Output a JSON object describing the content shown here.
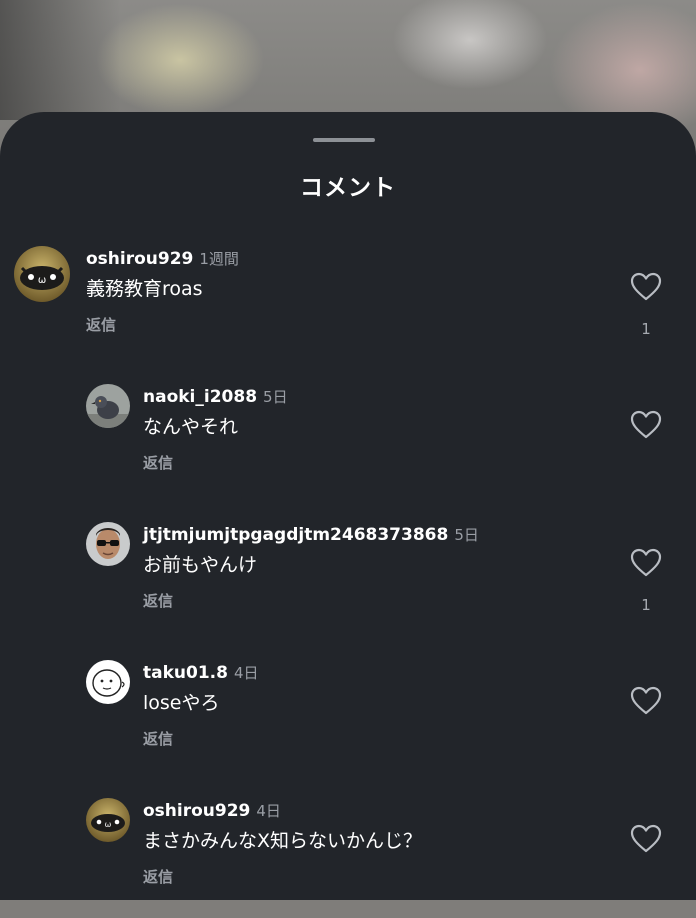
{
  "sheet": {
    "title": "コメント"
  },
  "comments": [
    {
      "username": "oshirou929",
      "time": "1週間",
      "text": "義務教育roas",
      "reply_label": "返信",
      "likes": "1",
      "avatar": "cat-face-avatar-icon"
    },
    {
      "username": "naoki_i2088",
      "time": "5日",
      "text": "なんやそれ",
      "reply_label": "返信",
      "likes": "",
      "avatar": "pigeon-avatar-icon"
    },
    {
      "username": "jtjtmjumjtpgagdjtm2468373868",
      "time": "5日",
      "text": "お前もやんけ",
      "reply_label": "返信",
      "likes": "1",
      "avatar": "person-sunglasses-avatar-icon"
    },
    {
      "username": "taku01.8",
      "time": "4日",
      "text": "loseやろ",
      "reply_label": "返信",
      "likes": "",
      "avatar": "doodle-face-avatar-icon"
    },
    {
      "username": "oshirou929",
      "time": "4日",
      "text": "まさかみんなX知らないかんじ？",
      "reply_label": "返信",
      "likes": "",
      "avatar": "cat-face-avatar-icon"
    }
  ],
  "icons": {
    "like": "heart-outline-icon"
  },
  "colors": {
    "sheet_bg": "#22252a",
    "secondary_text": "#9a9ea5",
    "primary_text": "#ffffff"
  }
}
